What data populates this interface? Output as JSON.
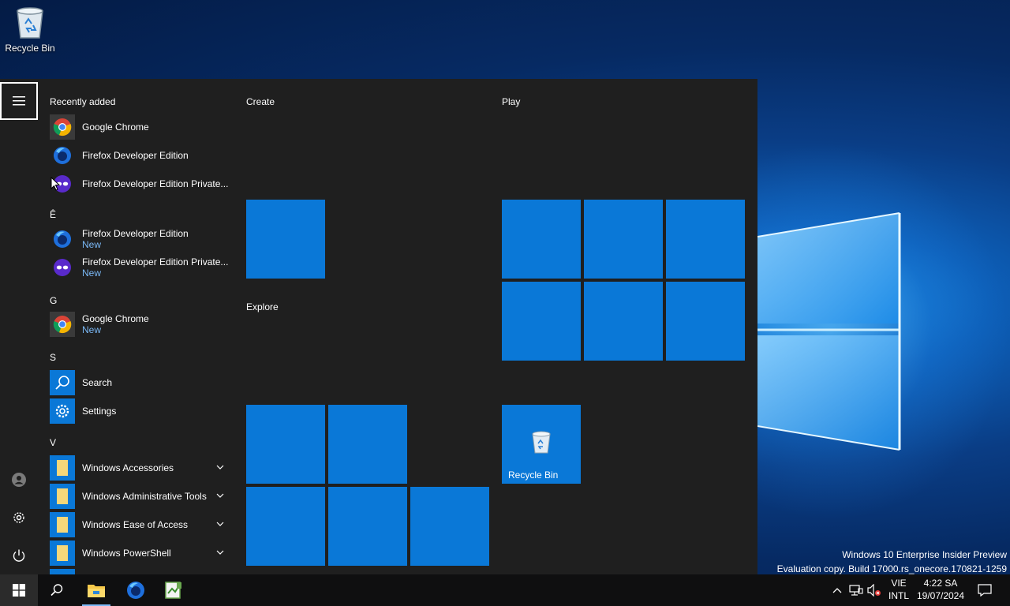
{
  "desktop": {
    "recycle_bin_label": "Recycle Bin"
  },
  "start_menu": {
    "recently_added": {
      "header": "Recently added",
      "items": [
        {
          "name": "Google Chrome"
        },
        {
          "name": "Firefox Developer Edition"
        },
        {
          "name": "Firefox Developer Edition Private..."
        }
      ]
    },
    "sections": [
      {
        "letter": "Ê",
        "items": [
          {
            "name": "Firefox Developer Edition",
            "badge": "New"
          },
          {
            "name": "Firefox Developer Edition Private...",
            "badge": "New"
          }
        ]
      },
      {
        "letter": "G",
        "items": [
          {
            "name": "Google Chrome",
            "badge": "New"
          }
        ]
      },
      {
        "letter": "S",
        "items": [
          {
            "name": "Search"
          },
          {
            "name": "Settings"
          }
        ]
      },
      {
        "letter": "V",
        "items": [
          {
            "name": "Windows Accessories"
          },
          {
            "name": "Windows Administrative Tools"
          },
          {
            "name": "Windows Ease of Access"
          },
          {
            "name": "Windows PowerShell"
          }
        ]
      }
    ],
    "groups": {
      "create": "Create",
      "explore": "Explore",
      "play": "Play"
    },
    "tile_recycle_bin_label": "Recycle Bin"
  },
  "watermark": {
    "line1": "Windows 10 Enterprise Insider Preview",
    "line2": "Evaluation copy. Build 17000.rs_onecore.170821-1259"
  },
  "taskbar": {
    "language_top": "VIE",
    "language_bottom": "INTL",
    "time": "4:22 SA",
    "date": "19/07/2024"
  },
  "colors": {
    "tile_blue": "#0a78d7",
    "menu_background": "#1f1f1f",
    "new_badge": "#7ab8f5"
  }
}
